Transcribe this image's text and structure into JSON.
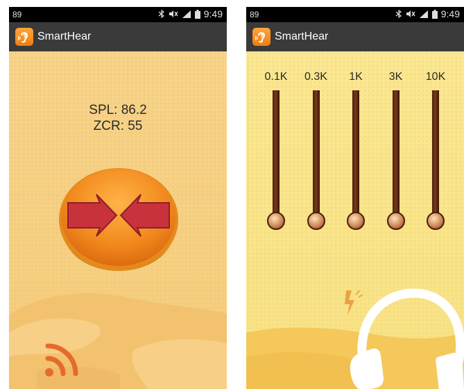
{
  "screens": [
    {
      "status": {
        "left_text": "89",
        "time": "9:49"
      },
      "app_title": "SmartHear",
      "readouts": {
        "spl": "SPL: 86.2",
        "zcr": "ZCR: 55"
      }
    },
    {
      "status": {
        "left_text": "89",
        "time": "9:49"
      },
      "app_title": "SmartHear",
      "equalizer": {
        "bands": [
          {
            "label": "0.1K",
            "level": 0
          },
          {
            "label": "0.3K",
            "level": 0
          },
          {
            "label": "1K",
            "level": 0
          },
          {
            "label": "3K",
            "level": 0
          },
          {
            "label": "10K",
            "level": 0
          }
        ]
      }
    }
  ],
  "colors": {
    "app_bar": "#3a3a3a",
    "accent_orange": "#f07d10",
    "left_background": "#f6d085",
    "right_background": "#f9e48c",
    "arrow_red": "#c8323c",
    "slider_brown": "#5a260f"
  },
  "icons": [
    "bluetooth-icon",
    "mute-icon",
    "signal-icon",
    "battery-icon",
    "ear-icon",
    "power-button-arrows-icon",
    "wifi-signal-icon",
    "headphones-icon",
    "lightning-icon"
  ]
}
